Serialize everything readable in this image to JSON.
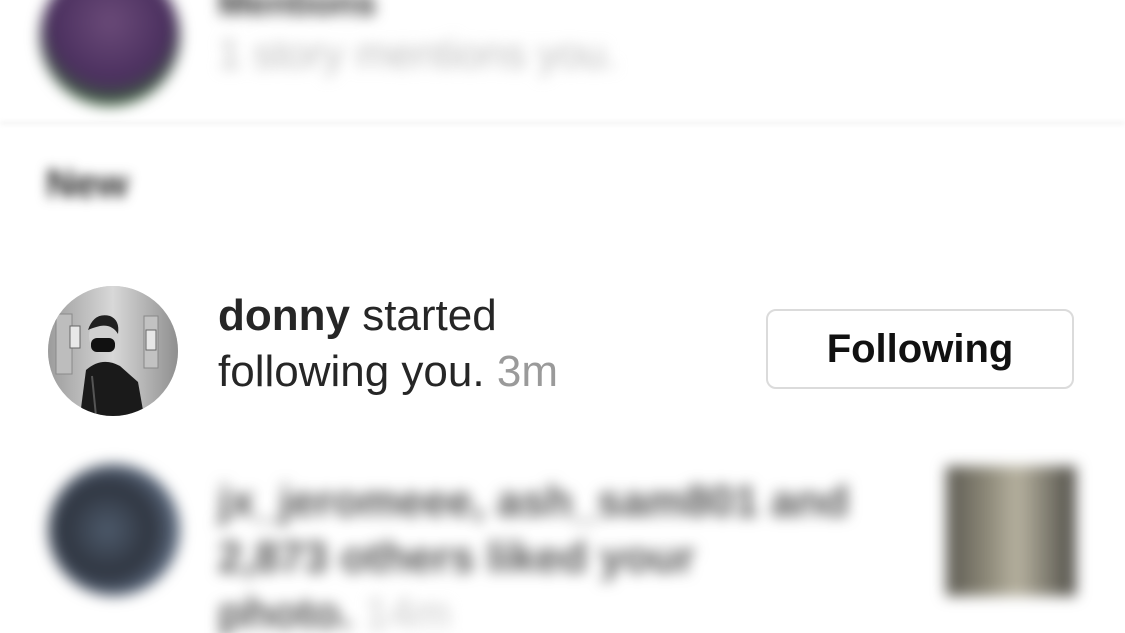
{
  "mentions": {
    "title": "Mentions",
    "subtitle": "1 story mentions you."
  },
  "section": {
    "title": "New"
  },
  "follow_notification": {
    "username": "donny",
    "action_line1": " started",
    "action_line2": "following you.",
    "time": "3m",
    "button_label": "Following"
  },
  "likes_notification": {
    "text_line1": "jx_jeromeee, ash_sam801 and",
    "text_line2": "2,873 others liked your",
    "text_line3": "photo.",
    "time": "14m"
  }
}
